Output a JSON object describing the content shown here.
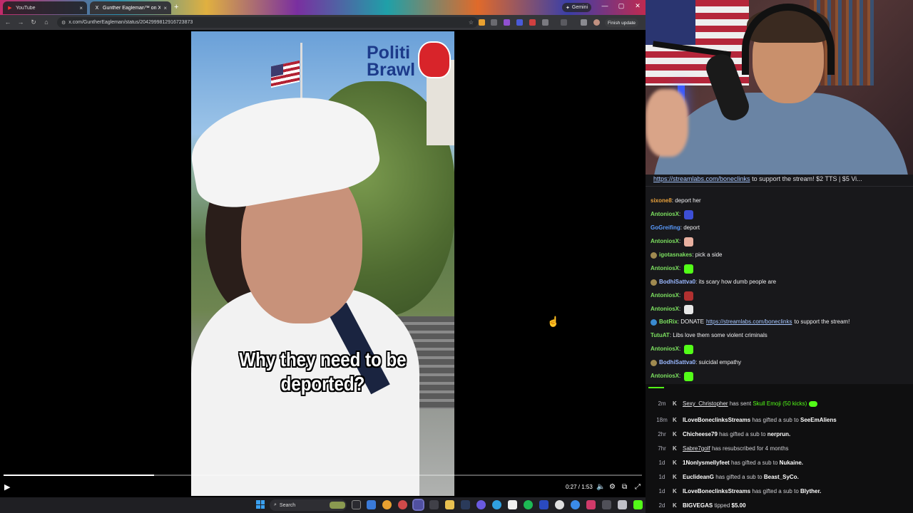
{
  "browser": {
    "tabs": [
      {
        "title": "YouTube",
        "close": "×"
      },
      {
        "title": "Gunther Eagleman™ on X:",
        "close": "×"
      }
    ],
    "new_tab": "+",
    "gemini_label": "Gemini",
    "window_controls": {
      "minimize": "—",
      "maximize": "▢",
      "close": "✕"
    },
    "url": "x.com/GuntherEagleman/status/2042999812916723873",
    "finish_update": "Finish update"
  },
  "video": {
    "logo_line1": "Politi",
    "logo_line2": "Brawl",
    "caption": "Why they need to be deported?",
    "time": "0:27 / 1:53",
    "progress": 0.236
  },
  "chat": {
    "pinned_link": "https://streamlabs.com/boneclinks",
    "pinned_rest": "to support the stream! $2 TTS | $5 Vi...",
    "messages": [
      {
        "user": "sixone8",
        "color": "#e8a13c",
        "text": "deport her",
        "badge": "",
        "emote": ""
      },
      {
        "user": "AntoniosX",
        "color": "#7ce060",
        "text": "",
        "badge": "",
        "emote": "#3d4fd6"
      },
      {
        "user": "GoGreifing",
        "color": "#5a9cff",
        "text": "deport",
        "badge": "",
        "emote": ""
      },
      {
        "user": "AntoniosX",
        "color": "#7ce060",
        "text": "",
        "badge": "",
        "emote": "#e8b0a0"
      },
      {
        "user": "igotasnakes",
        "color": "#7ce060",
        "text": "pick a side",
        "badge": "#a08a50",
        "emote": ""
      },
      {
        "user": "AntoniosX",
        "color": "#7ce060",
        "text": "",
        "badge": "",
        "emote": "#53fc18"
      },
      {
        "user": "BodhiSattva0",
        "color": "#9ab8ff",
        "text": "its scary how dumb people are",
        "badge": "#a08a50",
        "emote": ""
      },
      {
        "user": "AntoniosX",
        "color": "#7ce060",
        "text": "",
        "badge": "",
        "emote": "#b03030"
      },
      {
        "user": "AntoniosX",
        "color": "#7ce060",
        "text": "",
        "badge": "",
        "emote": "#e8e8e8"
      },
      {
        "user": "BotRix",
        "color": "#7ce060",
        "text_before": "DONATE",
        "link": "https://streamlabs.com/boneclinks",
        "text_after": "to support the stream!",
        "badge": "#3a8ad0"
      },
      {
        "user": "TutuAT",
        "color": "#7ce060",
        "text": "Libs love them some violent criminals",
        "badge": "",
        "emote": ""
      },
      {
        "user": "AntoniosX",
        "color": "#7ce060",
        "text": "",
        "badge": "",
        "emote": "#53fc18"
      },
      {
        "user": "BodhiSattva0",
        "color": "#9ab8ff",
        "text": "suicidal empathy",
        "badge": "#a08a50",
        "emote": ""
      },
      {
        "user": "AntoniosX",
        "color": "#7ce060",
        "text": "",
        "badge": "",
        "emote": "#53fc18"
      }
    ]
  },
  "events": [
    {
      "age": "2m",
      "user": "Sexy_Christopher",
      "action": "has sent",
      "target": "Skull Emoji (50 kicks)",
      "target_class": "green"
    },
    {
      "age": "18m",
      "user": "ILoveBoneclinksStreams",
      "action": "has gifted a sub to",
      "target": "SeeEmAliens",
      "target_class": "bold"
    },
    {
      "age": "2hr",
      "user": "Chicheese79",
      "action": "has gifted a sub to",
      "target": "nerprun.",
      "target_class": "bold"
    },
    {
      "age": "7hr",
      "user": "Sabre7golf",
      "action": "has resubscribed for 4 months",
      "target": "",
      "target_class": ""
    },
    {
      "age": "1d",
      "user": "1Nonlysmellyfeet",
      "action": "has gifted a sub to",
      "target": "Nukaine.",
      "target_class": "bold"
    },
    {
      "age": "1d",
      "user": "EuclideanG",
      "action": "has gifted a sub to",
      "target": "Beast_SyCo.",
      "target_class": "bold"
    },
    {
      "age": "1d",
      "user": "ILoveBoneclinksStreams",
      "action": "has gifted a sub to",
      "target": "Blyther.",
      "target_class": "bold"
    },
    {
      "age": "2d",
      "user": "BIGVEGAS",
      "action": "tipped",
      "target": "$5.00",
      "target_class": "bold"
    }
  ],
  "taskbar": {
    "search_placeholder": "Search"
  }
}
